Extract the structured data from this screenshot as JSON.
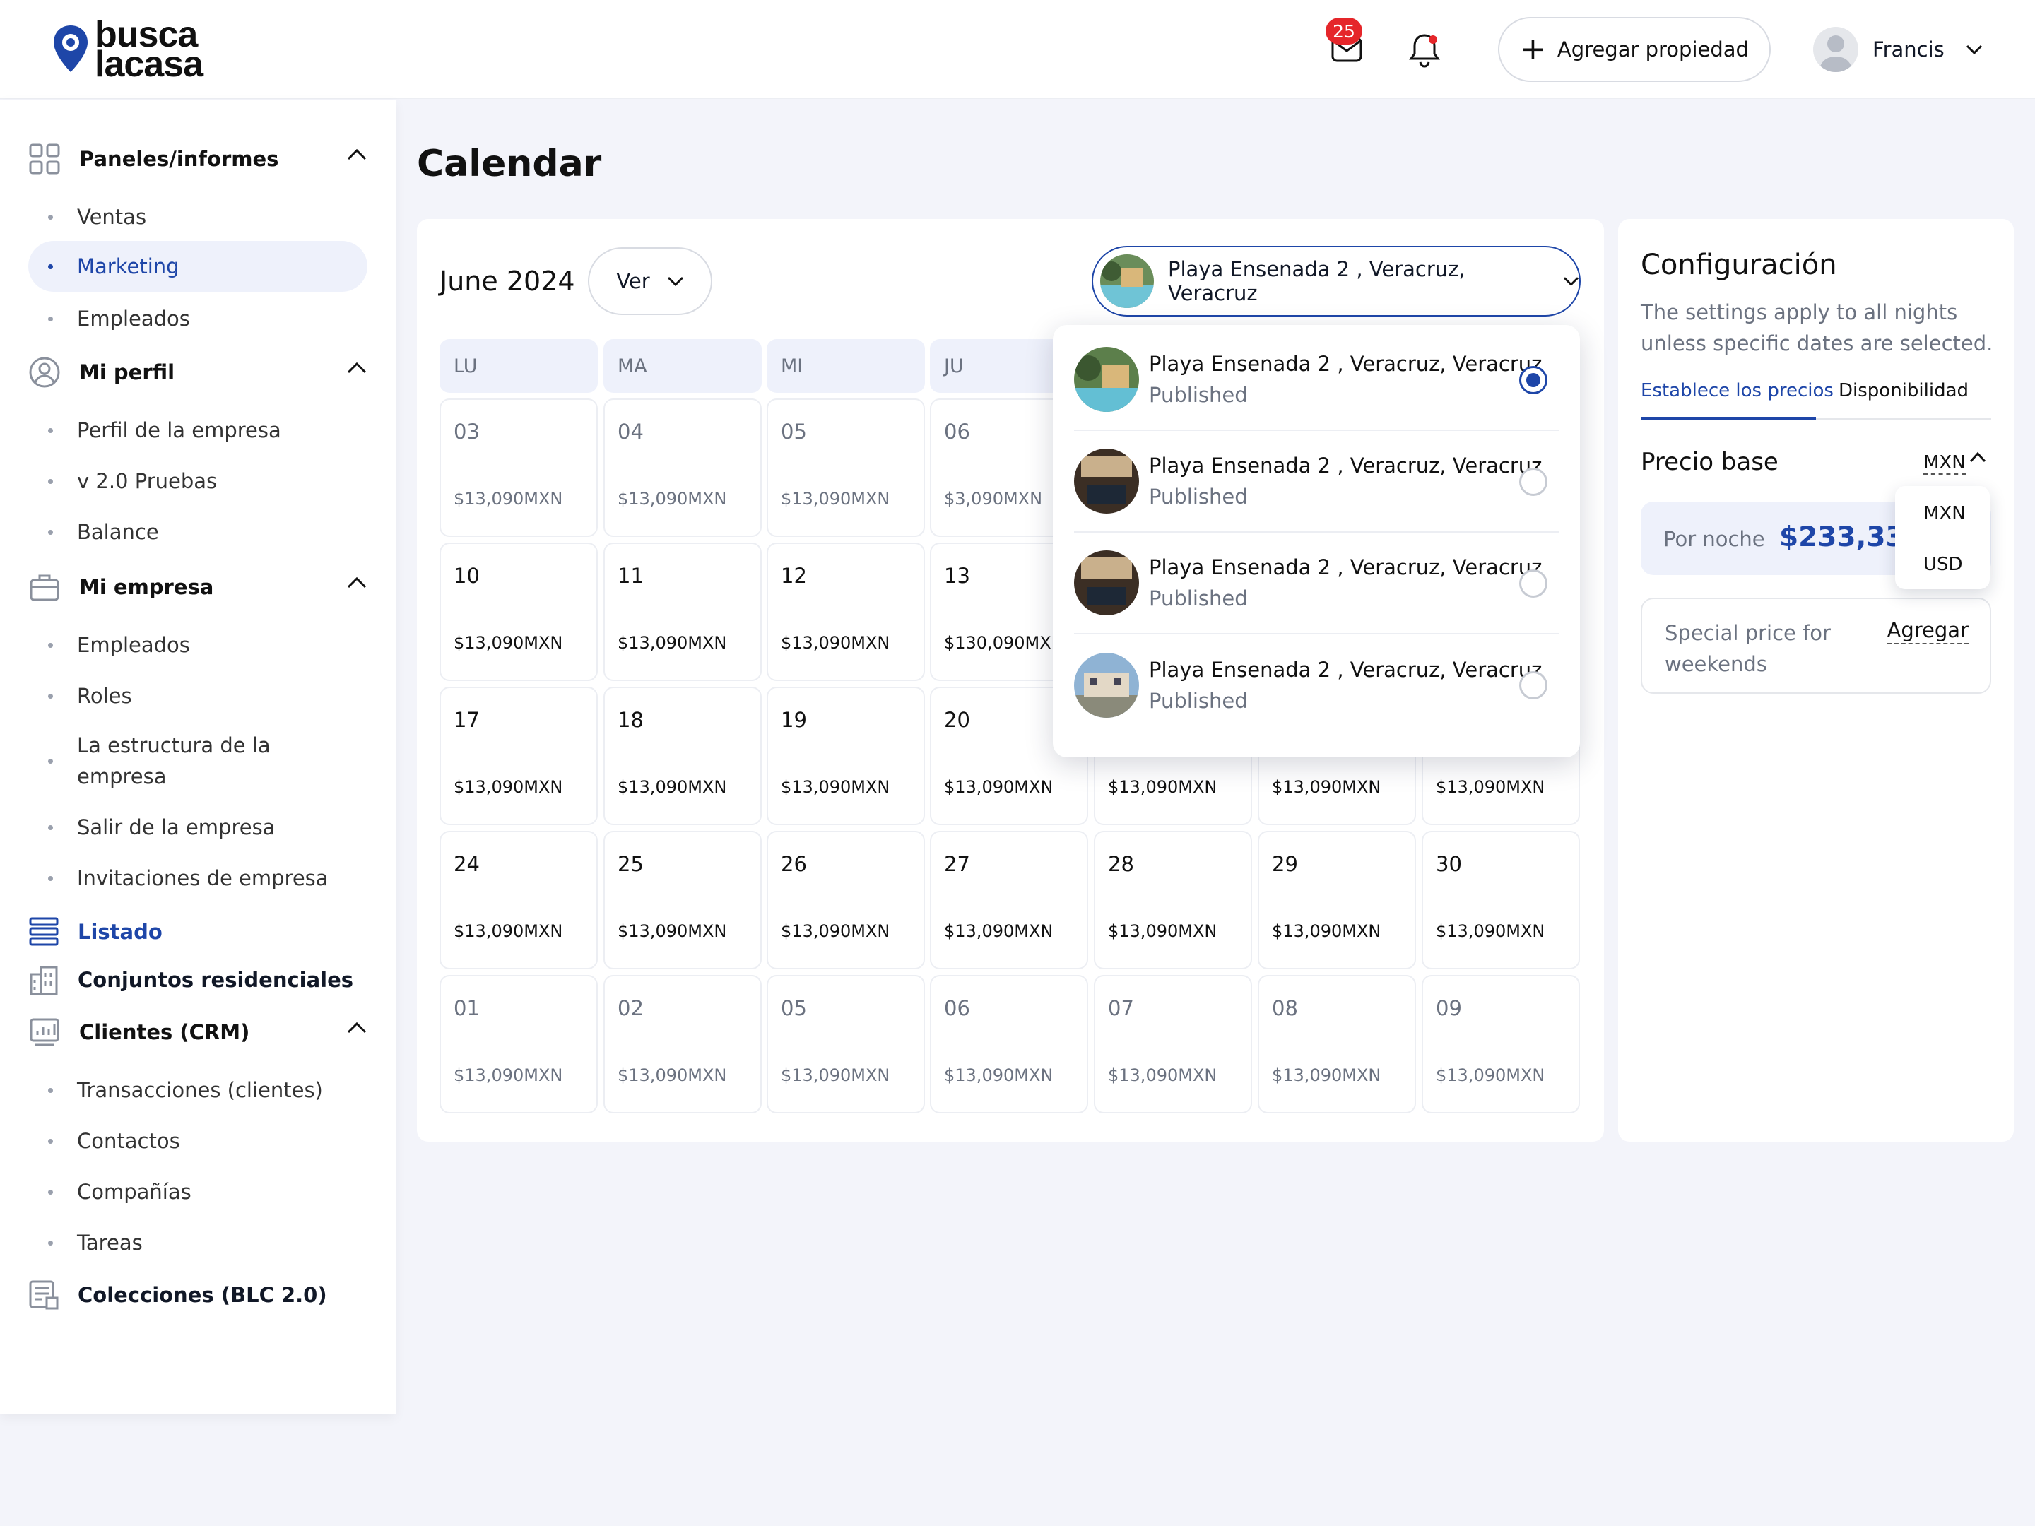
{
  "brand": {
    "line1": "busca",
    "line2": "lacasa"
  },
  "header": {
    "mail_count": "25",
    "add_property": "Agregar propiedad",
    "user_name": "Francis"
  },
  "sidebar": {
    "sec1": {
      "label": "Paneles/informes",
      "items": [
        "Ventas",
        "Marketing",
        "Empleados"
      ]
    },
    "sec2": {
      "label": "Mi perfil",
      "items": [
        "Perfil de la empresa",
        "v 2.0 Pruebas",
        "Balance"
      ]
    },
    "sec3": {
      "label": "Mi empresa",
      "items": [
        "Empleados",
        "Roles",
        "La estructura de la empresa",
        "Salir de la empresa",
        "Invitaciones de empresa"
      ]
    },
    "listado": "Listado",
    "conjuntos": "Conjuntos residenciales",
    "crm": {
      "label": "Clientes (CRM)",
      "items": [
        "Transacciones (clientes)",
        "Contactos",
        "Compañías",
        "Tareas"
      ]
    },
    "colecciones": "Colecciones (BLC 2.0)"
  },
  "page_title": "Calendar",
  "calendar": {
    "month": "June 2024",
    "view": "Ver",
    "selected_property": "Playa Ensenada 2 , Veracruz, Veracruz",
    "days": [
      "LU",
      "MA",
      "MI",
      "JU"
    ],
    "rows": [
      [
        {
          "n": "03",
          "p": "$13,090MXN"
        },
        {
          "n": "04",
          "p": "$13,090MXN"
        },
        {
          "n": "05",
          "p": "$13,090MXN"
        },
        {
          "n": "06",
          "p": "$3,090MXN"
        }
      ],
      [
        {
          "n": "10",
          "p": "$13,090MXN"
        },
        {
          "n": "11",
          "p": "$13,090MXN"
        },
        {
          "n": "12",
          "p": "$13,090MXN"
        },
        {
          "n": "13",
          "p": "$130,090MXN"
        }
      ],
      [
        {
          "n": "17",
          "p": "$13,090MXN"
        },
        {
          "n": "18",
          "p": "$13,090MXN"
        },
        {
          "n": "19",
          "p": "$13,090MXN"
        },
        {
          "n": "20",
          "p": "$13,090MXN"
        },
        {
          "n": "",
          "p": "$13,090MXN"
        },
        {
          "n": "",
          "p": "$13,090MXN"
        },
        {
          "n": "",
          "p": "$13,090MXN"
        }
      ],
      [
        {
          "n": "24",
          "p": "$13,090MXN"
        },
        {
          "n": "25",
          "p": "$13,090MXN"
        },
        {
          "n": "26",
          "p": "$13,090MXN"
        },
        {
          "n": "27",
          "p": "$13,090MXN"
        },
        {
          "n": "28",
          "p": "$13,090MXN"
        },
        {
          "n": "29",
          "p": "$13,090MXN"
        },
        {
          "n": "30",
          "p": "$13,090MXN"
        }
      ],
      [
        {
          "n": "01",
          "p": "$13,090MXN"
        },
        {
          "n": "02",
          "p": "$13,090MXN"
        },
        {
          "n": "05",
          "p": "$13,090MXN"
        },
        {
          "n": "06",
          "p": "$13,090MXN"
        },
        {
          "n": "07",
          "p": "$13,090MXN"
        },
        {
          "n": "08",
          "p": "$13,090MXN"
        },
        {
          "n": "09",
          "p": "$13,090MXN"
        }
      ]
    ]
  },
  "property_dropdown": [
    {
      "name": "Playa Ensenada 2 , Veracruz, Veracruz",
      "status": "Published",
      "selected": true
    },
    {
      "name": "Playa Ensenada 2 , Veracruz, Veracruz",
      "status": "Published",
      "selected": false
    },
    {
      "name": "Playa Ensenada 2 , Veracruz, Veracruz",
      "status": "Published",
      "selected": false
    },
    {
      "name": "Playa Ensenada 2 , Veracruz, Veracruz",
      "status": "Published",
      "selected": false
    }
  ],
  "config": {
    "title": "Configuración",
    "description": "The settings apply to all nights unless specific dates are selected.",
    "tab_prices": "Establece los precios",
    "tab_availability": "Disponibilidad",
    "base_price": "Precio base",
    "currency": "MXN",
    "currency_options": [
      "MXN",
      "USD"
    ],
    "per_night_label": "Por noche",
    "per_night_value": "$233,337",
    "special_label": "Special price for weekends",
    "special_action": "Agregar"
  },
  "colors": {
    "accent": "#1e46a8",
    "badge": "#e5262a",
    "background": "#f3f4fa"
  }
}
